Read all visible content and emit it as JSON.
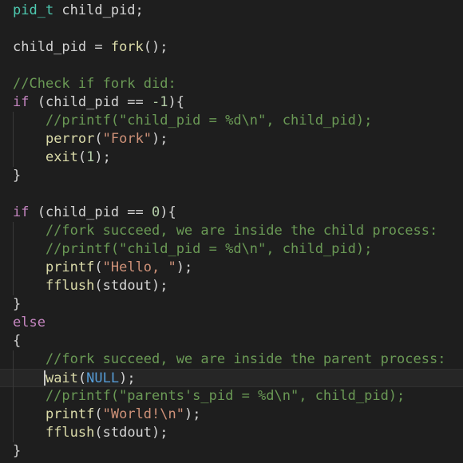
{
  "editor": {
    "lines": [
      [
        {
          "t": "pid_t",
          "c": "type"
        },
        {
          "t": " child_pid;",
          "c": "plain"
        }
      ],
      [],
      [
        {
          "t": "child_pid = ",
          "c": "plain"
        },
        {
          "t": "fork",
          "c": "fn"
        },
        {
          "t": "();",
          "c": "plain"
        }
      ],
      [],
      [
        {
          "t": "//Check if fork did:",
          "c": "comment"
        }
      ],
      [
        {
          "t": "if",
          "c": "kw"
        },
        {
          "t": " (child_pid == ",
          "c": "plain"
        },
        {
          "t": "-1",
          "c": "num"
        },
        {
          "t": "){",
          "c": "plain"
        }
      ],
      [
        {
          "t": "    //printf(\"child_pid = %d\\n\", child_pid);",
          "c": "comment"
        }
      ],
      [
        {
          "t": "    ",
          "c": "plain"
        },
        {
          "t": "perror",
          "c": "fn"
        },
        {
          "t": "(",
          "c": "plain"
        },
        {
          "t": "\"Fork\"",
          "c": "str"
        },
        {
          "t": ");",
          "c": "plain"
        }
      ],
      [
        {
          "t": "    ",
          "c": "plain"
        },
        {
          "t": "exit",
          "c": "fn"
        },
        {
          "t": "(",
          "c": "plain"
        },
        {
          "t": "1",
          "c": "num"
        },
        {
          "t": ");",
          "c": "plain"
        }
      ],
      [
        {
          "t": "}",
          "c": "plain"
        }
      ],
      [],
      [
        {
          "t": "if",
          "c": "kw"
        },
        {
          "t": " (child_pid == ",
          "c": "plain"
        },
        {
          "t": "0",
          "c": "num"
        },
        {
          "t": "){",
          "c": "plain"
        }
      ],
      [
        {
          "t": "    //fork succeed, we are inside the child process:",
          "c": "comment"
        }
      ],
      [
        {
          "t": "    //printf(\"child_pid = %d\\n\", child_pid);",
          "c": "comment"
        }
      ],
      [
        {
          "t": "    ",
          "c": "plain"
        },
        {
          "t": "printf",
          "c": "fn"
        },
        {
          "t": "(",
          "c": "plain"
        },
        {
          "t": "\"Hello, \"",
          "c": "str"
        },
        {
          "t": ");",
          "c": "plain"
        }
      ],
      [
        {
          "t": "    ",
          "c": "plain"
        },
        {
          "t": "fflush",
          "c": "fn"
        },
        {
          "t": "(stdout);",
          "c": "plain"
        }
      ],
      [
        {
          "t": "}",
          "c": "plain"
        }
      ],
      [
        {
          "t": "else",
          "c": "kw"
        }
      ],
      [
        {
          "t": "{",
          "c": "plain"
        }
      ],
      [
        {
          "t": "    //fork succeed, we are inside the parent process:",
          "c": "comment"
        }
      ],
      [
        {
          "t": "    ",
          "c": "plain"
        },
        {
          "t": "wait",
          "c": "fn"
        },
        {
          "t": "(",
          "c": "plain"
        },
        {
          "t": "NULL",
          "c": "const"
        },
        {
          "t": ");",
          "c": "plain"
        }
      ],
      [
        {
          "t": "    //printf(\"parents's_pid = %d\\n\", child_pid);",
          "c": "comment"
        }
      ],
      [
        {
          "t": "    ",
          "c": "plain"
        },
        {
          "t": "printf",
          "c": "fn"
        },
        {
          "t": "(",
          "c": "plain"
        },
        {
          "t": "\"World!\\n\"",
          "c": "str"
        },
        {
          "t": ");",
          "c": "plain"
        }
      ],
      [
        {
          "t": "    ",
          "c": "plain"
        },
        {
          "t": "fflush",
          "c": "fn"
        },
        {
          "t": "(stdout);",
          "c": "plain"
        }
      ],
      [
        {
          "t": "}",
          "c": "plain"
        }
      ]
    ]
  }
}
